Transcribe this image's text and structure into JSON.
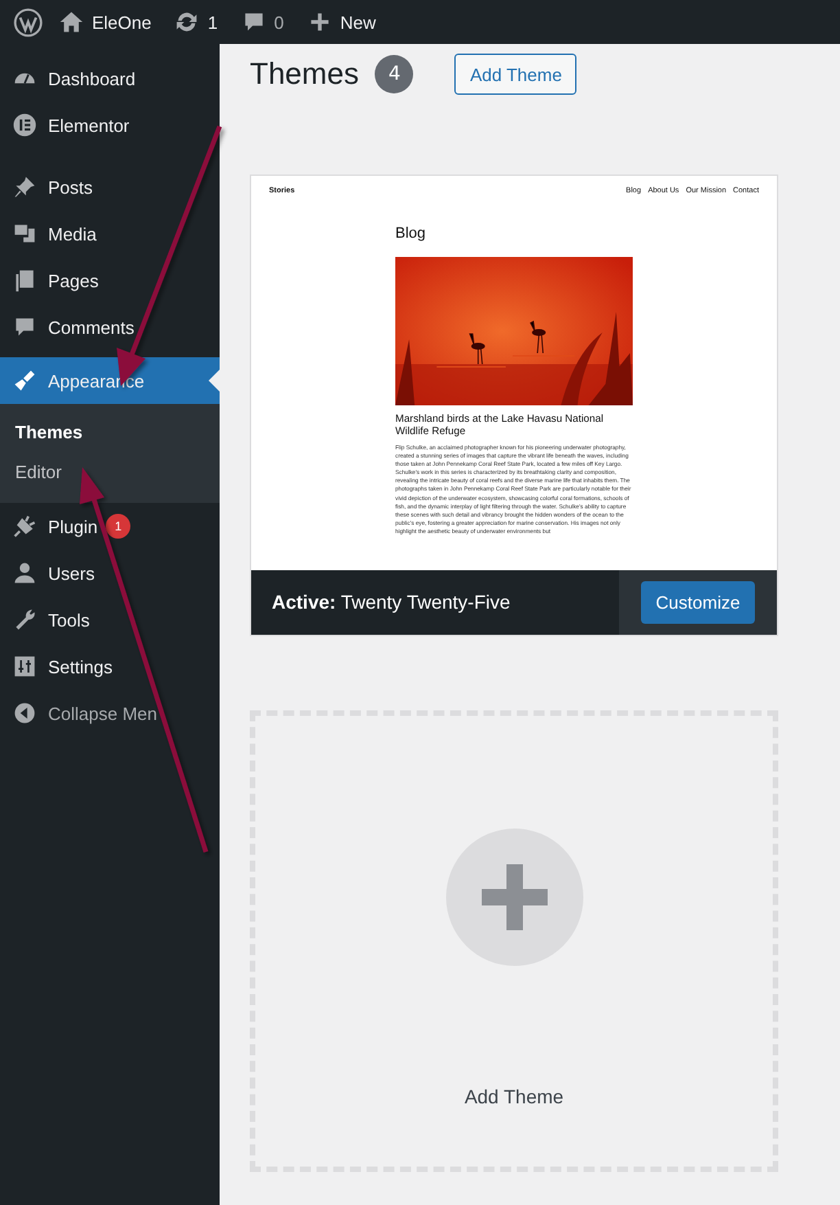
{
  "admin_bar": {
    "site_name": "EleOne",
    "updates": "1",
    "comments": "0",
    "new_label": "New"
  },
  "sidebar": {
    "items": [
      {
        "label": "Dashboard",
        "selected": false
      },
      {
        "label": "Elementor",
        "selected": false
      },
      {
        "label": "Posts",
        "selected": false
      },
      {
        "label": "Media",
        "selected": false
      },
      {
        "label": "Pages",
        "selected": false
      },
      {
        "label": "Comments",
        "selected": false
      },
      {
        "label": "Appearance",
        "selected": true,
        "children": [
          {
            "label": "Themes",
            "selected": true
          },
          {
            "label": "Editor",
            "selected": false
          }
        ]
      },
      {
        "label": "Plugin",
        "selected": false,
        "badge": "1"
      },
      {
        "label": "Users",
        "selected": false
      },
      {
        "label": "Tools",
        "selected": false
      },
      {
        "label": "Settings",
        "selected": false
      }
    ],
    "collapse_label": "Collapse Men"
  },
  "page": {
    "title": "Themes",
    "count": "4",
    "add_button": "Add Theme"
  },
  "themes": [
    {
      "kind": "installed",
      "status": "**Active:** Twenty Twenty-Five",
      "button": "Customize",
      "preview": {
        "site_title": "Stories",
        "nav": [
          "Blog",
          "About Us",
          "Our Mission",
          "Contact"
        ],
        "heading": "Blog",
        "post_title": "Marshland birds at the Lake Havasu National Wildlife Refuge",
        "excerpt": "Flip Schulke, an acclaimed photographer known for his pioneering underwater photography, created a stunning series of images that capture the vibrant life beneath the waves, including those taken at John Pennekamp Coral Reef State Park, located a few miles off Key Largo. Schulke's work in this series is characterized by its breathtaking clarity and composition, revealing the intricate beauty of coral reefs and the diverse marine life that inhabits them. The photographs taken in John Pennekamp Coral Reef State Park are particularly notable for their vivid depiction of the underwater ecosystem, showcasing colorful coral formations, schools of fish, and the dynamic interplay of light filtering through the water. Schulke's ability to capture these scenes with such detail and vibrancy brought the hidden wonders of the ocean to the public's eye, fostering a greater appreciation for marine conservation. His images not only highlight the aesthetic beauty of underwater environments but"
      }
    },
    {
      "kind": "add",
      "label": "Add Theme"
    }
  ]
}
